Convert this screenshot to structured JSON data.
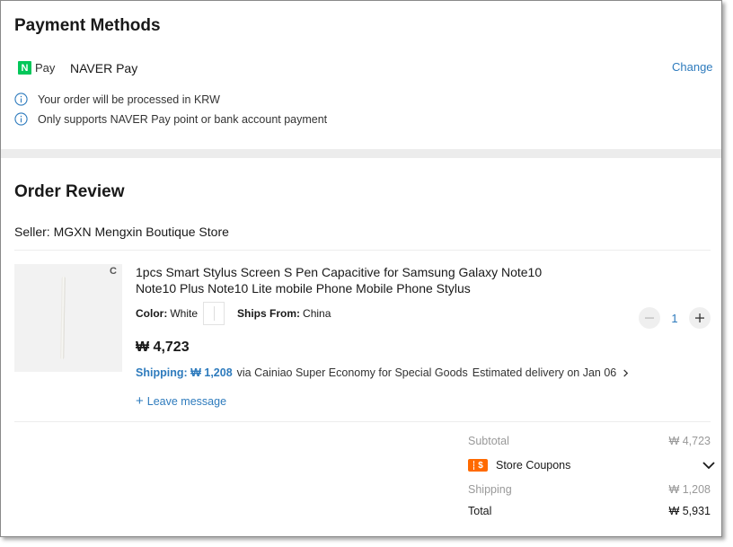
{
  "payment_methods": {
    "title": "Payment Methods",
    "badge_letter": "N",
    "badge_pay": "Pay",
    "method_name": "NAVER Pay",
    "change_label": "Change",
    "info": [
      "Your order will be processed in KRW",
      "Only supports NAVER Pay point or bank account payment"
    ]
  },
  "order_review": {
    "title": "Order Review",
    "seller": "Seller: MGXN Mengxin Boutique Store",
    "item": {
      "image_mark": "C",
      "title": "1pcs Smart Stylus Screen S Pen Capacitive for Samsung Galaxy Note10 Note10 Plus Note10 Lite mobile Phone Mobile Phone Stylus",
      "color_label": "Color:",
      "color_value": "White",
      "ships_from_label": "Ships From:",
      "ships_from_value": "China",
      "price": "₩ 4,723",
      "shipping_label": "Shipping: ₩ 1,208",
      "shipping_method": "via Cainiao Super Economy for Special Goods",
      "delivery": "Estimated delivery on Jan 06",
      "leave_message": "Leave message",
      "quantity": "1"
    }
  },
  "summary": {
    "subtotal_label": "Subtotal",
    "subtotal_value": "₩ 4,723",
    "coupons_label": "Store Coupons",
    "coupon_icon_text": "$",
    "shipping_label": "Shipping",
    "shipping_value": "₩ 1,208",
    "total_label": "Total",
    "total_value": "₩ 5,931"
  },
  "colors": {
    "accent_blue": "#2e7bbd",
    "naver_green": "#03c75a",
    "coupon_orange": "#ff6a00"
  }
}
